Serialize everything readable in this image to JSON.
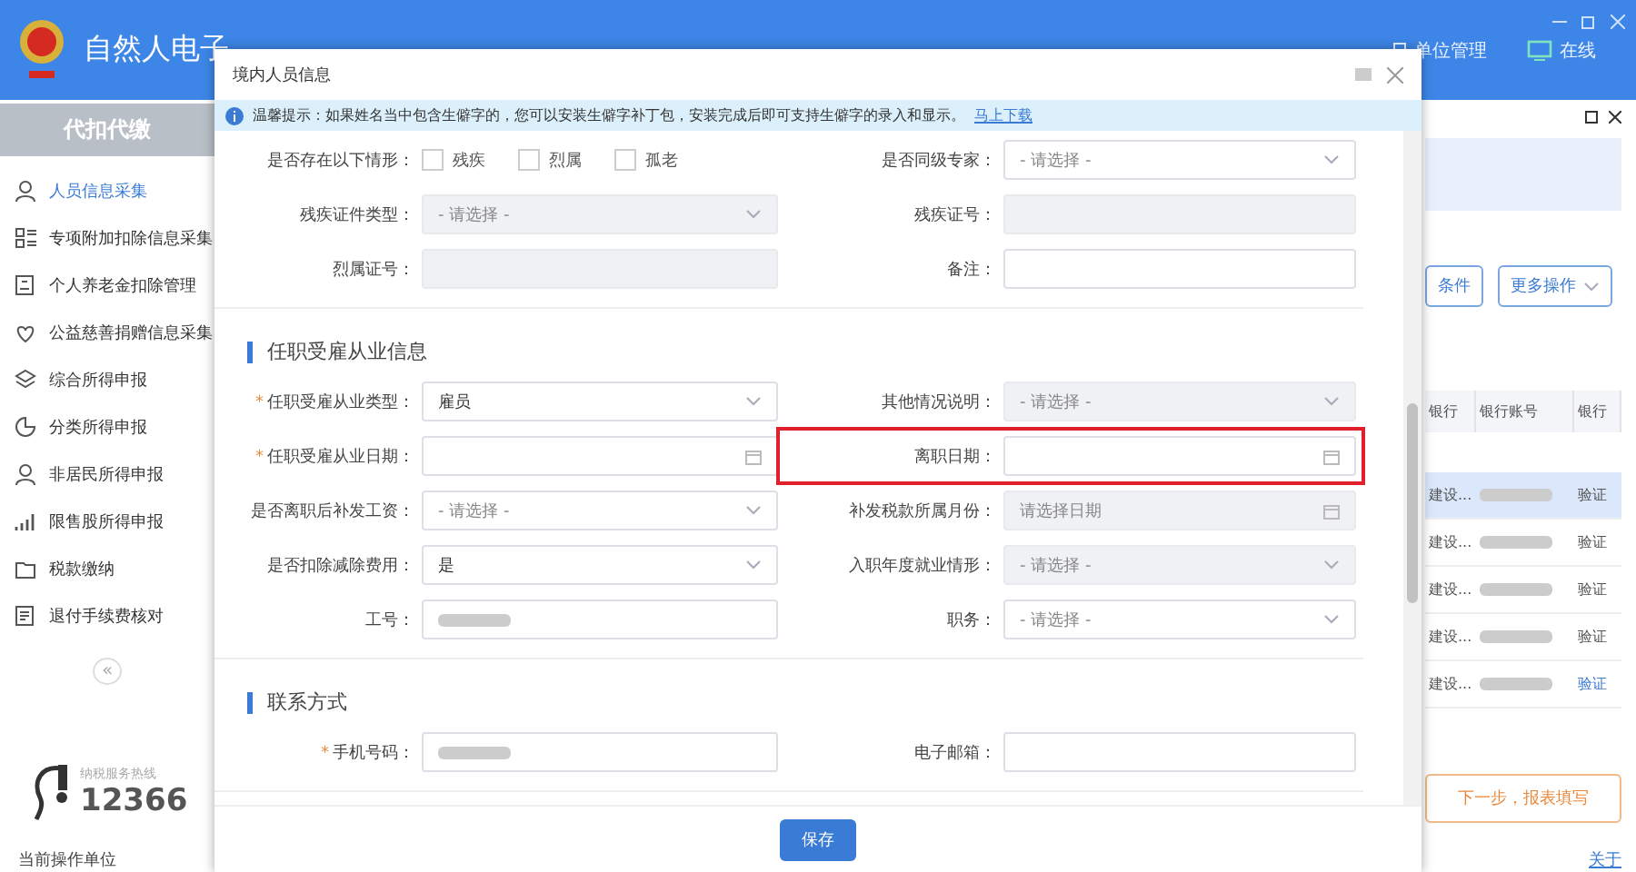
{
  "app": {
    "title": "自然人电子",
    "header_actions": [
      {
        "label": "单位管理",
        "kind": "unit"
      },
      {
        "label": "在线",
        "kind": "online"
      }
    ]
  },
  "sidebar": {
    "section": "代扣代缴",
    "items": [
      {
        "label": "人员信息采集",
        "selected": true
      },
      {
        "label": "专项附加扣除信息采集",
        "selected": false
      },
      {
        "label": "个人养老金扣除管理",
        "selected": false
      },
      {
        "label": "公益慈善捐赠信息采集",
        "selected": false
      },
      {
        "label": "综合所得申报",
        "selected": false
      },
      {
        "label": "分类所得申报",
        "selected": false
      },
      {
        "label": "非居民所得申报",
        "selected": false
      },
      {
        "label": "限售股所得申报",
        "selected": false
      },
      {
        "label": "税款缴纳",
        "selected": false
      },
      {
        "label": "退付手续费核对",
        "selected": false
      }
    ],
    "collapse": "«",
    "hotline": {
      "label": "纳税服务热线",
      "number": "12366"
    },
    "footer": "当前操作单位"
  },
  "right_panel": {
    "buttons": [
      {
        "label": "条件",
        "caret": false
      },
      {
        "label": "更多操作",
        "caret": true
      }
    ],
    "columns": [
      "银行",
      "银行账号",
      "银行"
    ],
    "rows": [
      {
        "bank": "建设...",
        "masked": true,
        "action": "验证",
        "selected": true,
        "active": false
      },
      {
        "bank": "建设...",
        "masked": true,
        "action": "验证",
        "selected": false,
        "active": false
      },
      {
        "bank": "建设...",
        "masked": true,
        "action": "验证",
        "selected": false,
        "active": false
      },
      {
        "bank": "建设...",
        "masked": true,
        "action": "验证",
        "selected": false,
        "active": false
      },
      {
        "bank": "建设...",
        "masked": true,
        "action": "验证",
        "selected": false,
        "active": true
      }
    ],
    "next_button": "下一步，报表填写",
    "about": "关于"
  },
  "dialog": {
    "title": "境内人员信息",
    "tip": {
      "text": "温馨提示：如果姓名当中包含生僻字的，您可以安装生僻字补丁包，安装完成后即可支持生僻字的录入和显示。",
      "link": "马上下载"
    },
    "blocks": [
      {
        "kind": "fields",
        "rows": [
          [
            {
              "label": "是否存在以下情形：",
              "kind": "checks",
              "options": [
                {
                  "label": "残疾",
                  "checked": false
                },
                {
                  "label": "烈属",
                  "checked": false
                },
                {
                  "label": "孤老",
                  "checked": false
                }
              ]
            },
            {
              "label": "是否同级专家：",
              "kind": "select",
              "placeholder": "- 请选择 -",
              "disabled": false
            }
          ],
          [
            {
              "label": "残疾证件类型：",
              "kind": "select",
              "placeholder": "- 请选择 -",
              "disabled": true
            },
            {
              "label": "残疾证号：",
              "kind": "input",
              "disabled": true
            }
          ],
          [
            {
              "label": "烈属证号：",
              "kind": "input",
              "disabled": true
            },
            {
              "label": "备注：",
              "kind": "input",
              "disabled": false
            }
          ]
        ]
      },
      {
        "kind": "section",
        "title": "任职受雇从业信息"
      },
      {
        "kind": "fields",
        "rows": [
          [
            {
              "label": "任职受雇从业类型：",
              "mark": "*",
              "kind": "select",
              "value": "雇员",
              "disabled": false
            },
            {
              "label": "其他情况说明：",
              "kind": "select",
              "placeholder": "- 请选择 -",
              "disabled": true
            }
          ],
          [
            {
              "label": "任职受雇从业日期：",
              "mark": "*",
              "kind": "date",
              "disabled": false
            },
            {
              "label": "离职日期：",
              "kind": "date",
              "disabled": false,
              "highlighted": true
            }
          ],
          [
            {
              "label": "是否离职后补发工资：",
              "kind": "select",
              "placeholder": "- 请选择 -",
              "disabled": false
            },
            {
              "label": "补发税款所属月份：",
              "kind": "date",
              "placeholder": "请选择日期",
              "disabled": true
            }
          ],
          [
            {
              "label": "是否扣除减除费用：",
              "kind": "select",
              "value": "是",
              "disabled": false
            },
            {
              "label": "入职年度就业情形：",
              "kind": "select",
              "placeholder": "- 请选择 -",
              "disabled": true
            }
          ],
          [
            {
              "label": "工号：",
              "kind": "input",
              "masked": true,
              "disabled": false
            },
            {
              "label": "职务：",
              "kind": "select",
              "placeholder": "- 请选择 -",
              "disabled": false
            }
          ]
        ]
      },
      {
        "kind": "section",
        "title": "联系方式"
      },
      {
        "kind": "fields",
        "rows": [
          [
            {
              "label": "手机号码：",
              "mark": "*",
              "kind": "input",
              "masked": true,
              "disabled": false
            },
            {
              "label": "电子邮箱：",
              "kind": "input",
              "disabled": false
            }
          ]
        ]
      }
    ],
    "save": "保存"
  }
}
